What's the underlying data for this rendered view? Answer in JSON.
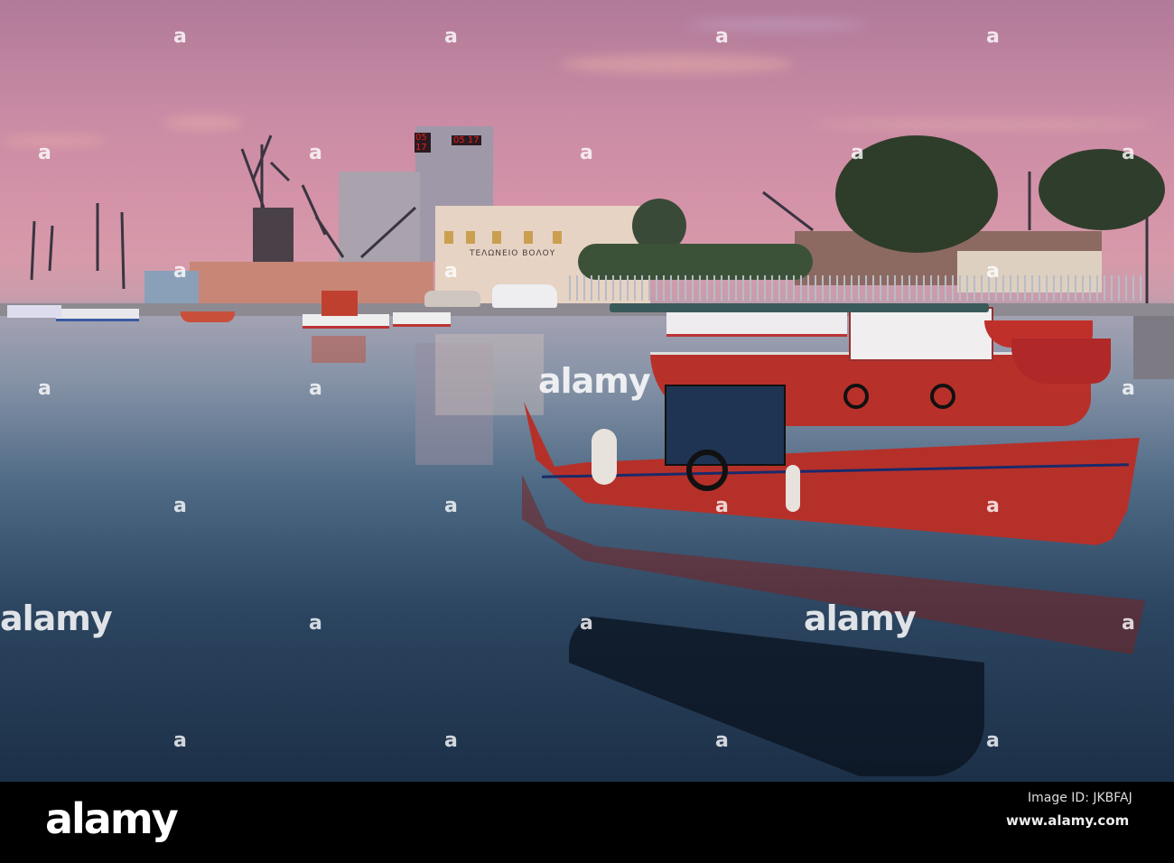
{
  "photo": {
    "sign_text": "ΤΕΛΩΝΕΙΟ ΒΟΛΟΥ",
    "clock_left": "05 17",
    "clock_right": "05 17"
  },
  "watermark": {
    "logo": "alamy",
    "mark": "a"
  },
  "footer": {
    "logo": "alamy",
    "image_id": "Image ID: JKBFAJ",
    "url": "www.alamy.com"
  },
  "colors": {
    "boat_red": "#b8302a",
    "sky": "#d493a8",
    "water": "#2c4560"
  }
}
